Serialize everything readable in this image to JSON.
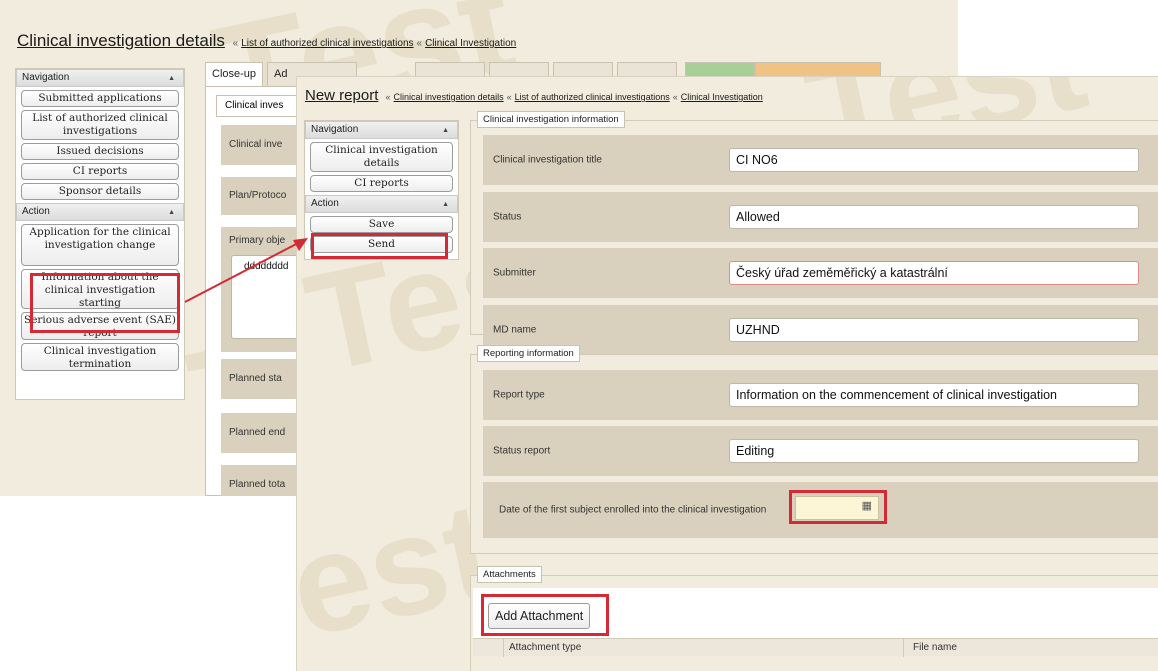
{
  "watermark_text": "Test",
  "back": {
    "title": "Clinical investigation details",
    "breadcrumb": [
      {
        "label": "List of authorized clinical investigations"
      },
      {
        "label": "Clinical Investigation"
      }
    ],
    "separator": "«",
    "nav_header": "Navigation",
    "nav_items": [
      {
        "label": "Submitted applications"
      },
      {
        "label": "List of authorized clinical investigations"
      },
      {
        "label": "Issued decisions"
      },
      {
        "label": "CI reports"
      },
      {
        "label": "Sponsor details"
      }
    ],
    "action_header": "Action",
    "action_items": [
      {
        "label": "Application for the clinical investigation change"
      },
      {
        "label": "Information about the clinical investigation starting"
      },
      {
        "label": "Serious adverse event (SAE) report"
      },
      {
        "label": "Clinical investigation termination"
      }
    ],
    "tabs": [
      {
        "label": "Close-up"
      },
      {
        "label": "Ad"
      }
    ],
    "sub_tab": "Clinical inves",
    "rows": [
      {
        "label": "Clinical inve"
      },
      {
        "label": "Plan/Protoco"
      },
      {
        "label": "Primary obje"
      },
      {
        "label": "Planned sta"
      },
      {
        "label": "Planned end"
      },
      {
        "label": "Planned tota"
      }
    ],
    "textarea_value": "dddddddd"
  },
  "front": {
    "title": "New report",
    "breadcrumb": [
      {
        "label": "Clinical investigation details"
      },
      {
        "label": "List of authorized clinical investigations"
      },
      {
        "label": "Clinical Investigation"
      }
    ],
    "nav_header": "Navigation",
    "nav_items": [
      {
        "label": "Clinical investigation details"
      },
      {
        "label": "CI reports"
      }
    ],
    "action_header": "Action",
    "action_items": [
      {
        "label": "Save"
      },
      {
        "label": "Send"
      }
    ],
    "ci_info": {
      "legend": "Clinical investigation information",
      "fields": [
        {
          "label": "Clinical investigation title",
          "value": "CI NO6"
        },
        {
          "label": "Status",
          "value": "Allowed"
        },
        {
          "label": "Submitter",
          "value": "Český úřad zeměměřický a katastrální"
        },
        {
          "label": "MD name",
          "value": "UZHND"
        }
      ]
    },
    "reporting": {
      "legend": "Reporting information",
      "fields": [
        {
          "label": "Report type",
          "value": "Information on the commencement of clinical investigation"
        },
        {
          "label": "Status report",
          "value": "Editing"
        }
      ],
      "date_label": "Date of the first subject enrolled into the clinical investigation",
      "date_value": ""
    },
    "attachments": {
      "legend": "Attachments",
      "add_button": "Add Attachment",
      "columns": [
        "Attachment type",
        "File name"
      ]
    }
  },
  "colors": {
    "highlight": "#d42a36",
    "panel_bg": "#f1ecde",
    "row_bg": "#d9d1bd",
    "tab_green": "#a8cf96",
    "tab_orange": "#f0c283"
  }
}
